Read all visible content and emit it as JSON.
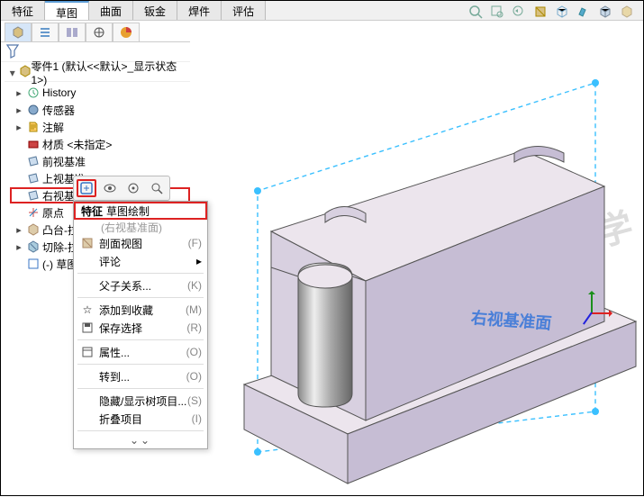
{
  "tabs": {
    "items": [
      "特征",
      "草图",
      "曲面",
      "钣金",
      "焊件",
      "评估"
    ],
    "active": 1
  },
  "panel_tabs": {
    "icons": [
      "cube",
      "list",
      "tree",
      "target",
      "pie"
    ],
    "active": 0
  },
  "hud": [
    "zoom-fit",
    "zoom-area",
    "zoom-prev",
    "section",
    "view-cube",
    "wrench",
    "display-style",
    "render-style"
  ],
  "tree": {
    "title": "零件1 (默认<<默认>_显示状态 1>)",
    "items": [
      {
        "icon": "history",
        "label": "History",
        "tw": "▸"
      },
      {
        "icon": "sensor",
        "label": "传感器",
        "tw": "▸"
      },
      {
        "icon": "note",
        "label": "注解",
        "tw": "▸"
      },
      {
        "icon": "material",
        "label": "材质 <未指定>",
        "tw": ""
      },
      {
        "icon": "plane",
        "label": "前视基准",
        "tw": ""
      },
      {
        "icon": "plane",
        "label": "上视基准",
        "tw": ""
      },
      {
        "icon": "plane",
        "label": "右视基准",
        "tw": "",
        "hl": true
      },
      {
        "icon": "origin",
        "label": "原点",
        "tw": ""
      },
      {
        "icon": "extrude",
        "label": "凸台-拉",
        "tw": "▸"
      },
      {
        "icon": "cut",
        "label": "切除-拉",
        "tw": "▸"
      },
      {
        "icon": "sketch",
        "label": "(-) 草图",
        "tw": ""
      }
    ]
  },
  "ctx_toolbar": [
    {
      "name": "sketch",
      "hl": true
    },
    {
      "name": "show"
    },
    {
      "name": "normal"
    },
    {
      "name": "zoom"
    }
  ],
  "popup": {
    "groups": [
      [
        {
          "label": "草图绘制",
          "sub": "(右视基准面)",
          "hl": true,
          "name": "sketch-draw"
        },
        {
          "label": "剖面视图",
          "hint": "(F)",
          "name": "section-view"
        },
        {
          "label": "评论",
          "arrow": true,
          "name": "comment"
        }
      ],
      [
        {
          "label": "父子关系...",
          "hint": "(K)",
          "name": "parent-child"
        }
      ],
      [
        {
          "label": "添加到收藏",
          "hint": "(M)",
          "name": "add-favorite"
        },
        {
          "label": "保存选择",
          "hint": "(R)",
          "name": "save-selection"
        }
      ],
      [
        {
          "label": "属性...",
          "hint": "(O)",
          "name": "properties"
        }
      ],
      [
        {
          "label": "转到...",
          "hint": "(O)",
          "name": "go-to"
        }
      ],
      [
        {
          "label": "隐藏/显示树项目...",
          "hint": "(S)",
          "name": "hide-show-tree"
        },
        {
          "label": "折叠项目",
          "hint": "(I)",
          "name": "collapse"
        }
      ]
    ]
  },
  "plane_label": "右视基准面",
  "watermark": "软件自学网"
}
